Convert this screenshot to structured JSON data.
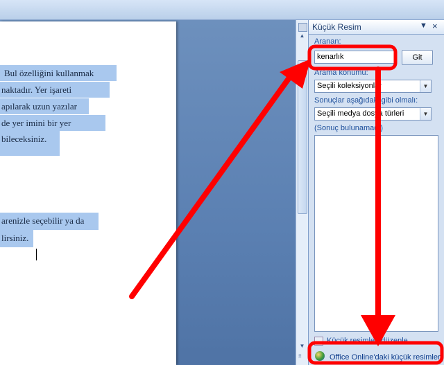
{
  "document": {
    "lines": [
      "Bul özelliğini  kullanmak",
      "naktadır.  Yer işareti",
      "apılarak  uzun yazılar",
      "de  yer imini bir  yer",
      "bileceksiniz.",
      "arenizle seçebilir ya da",
      "lirsiniz."
    ]
  },
  "pane": {
    "title": "Küçük Resim",
    "search_label": "Aranan:",
    "search_value": "kenarlık",
    "go_button": "Git",
    "location_label": "Arama konumu:",
    "location_value": "Seçili koleksiyonlar",
    "results_label": "Sonuçlar aşağıdaki gibi olmalı:",
    "results_type_value": "Seçili medya dosya türleri",
    "no_results": "(Sonuç bulunamadı)",
    "organize_link": "Küçük resimleri düzenle...",
    "online_link": "Office Online'daki küçük resimler"
  },
  "colors": {
    "annotation": "#ff0000",
    "selection": "#a9c8ee",
    "pane_background": "#d4e1f2",
    "link": "#1d4f9b"
  }
}
